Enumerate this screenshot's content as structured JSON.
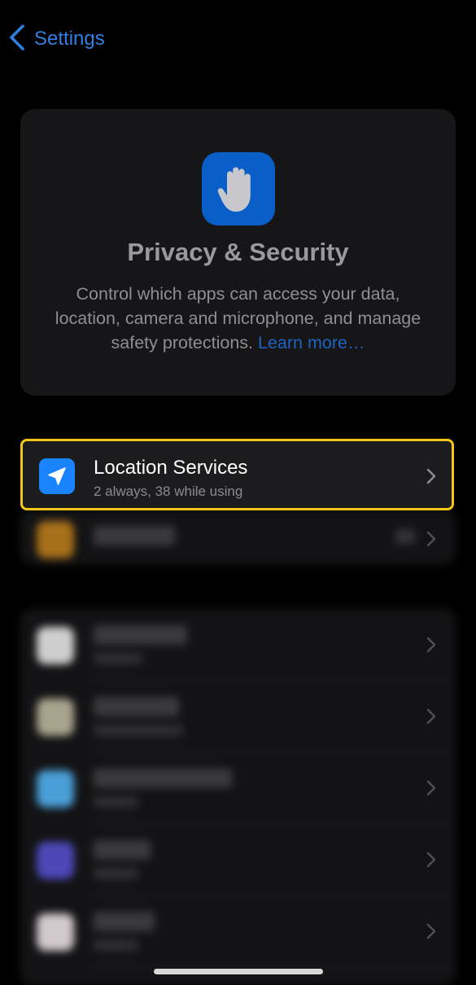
{
  "nav": {
    "back_label": "Settings",
    "back_icon": "chevron-left-icon"
  },
  "header": {
    "icon": "raised-hand-icon",
    "title": "Privacy & Security",
    "description": "Control which apps can access your data, location, camera and microphone, and manage safety protections.",
    "learn_more": "Learn more…"
  },
  "location_row": {
    "icon": "location-arrow-icon",
    "title": "Location Services",
    "subtitle": "2 always, 38 while using"
  },
  "colors": {
    "accent": "#2f7fe0",
    "highlight_border": "#f5c518",
    "location_icon_bg": "#1a84ff",
    "header_icon_bg": "#0a5ec8"
  }
}
